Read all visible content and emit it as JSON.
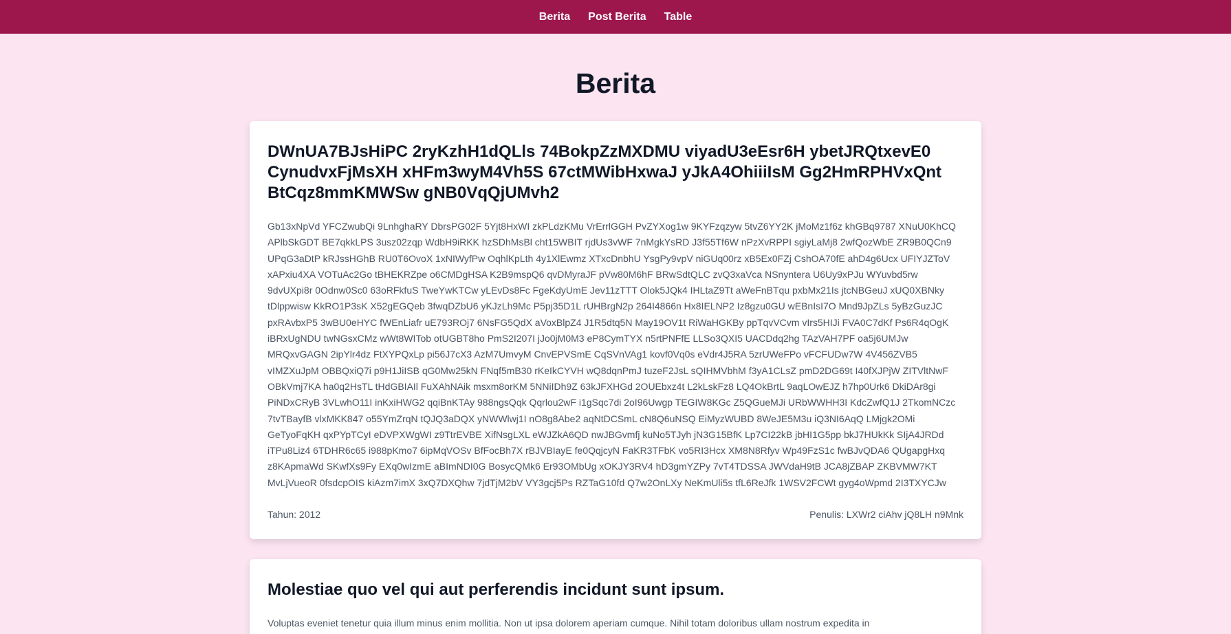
{
  "nav": {
    "items": [
      "Berita",
      "Post Berita",
      "Table"
    ]
  },
  "page": {
    "title": "Berita"
  },
  "articles": [
    {
      "title": "DWnUA7BJsHiPC 2ryKzhH1dQLls 74BokpZzMXDMU viyadU3eEsr6H ybetJRQtxevE0 CynudvxFjMsXH xHFm3wyM4Vh5S 67ctMWibHxwaJ yJkA4OhiiiIsM Gg2HmRPHVxQnt BtCqz8mmKMWSw gNB0VqQjUMvh2",
      "body": "Gb13xNpVd YFCZwubQi 9LnhghaRY DbrsPG02F 5Yjt8HxWI zkPLdzKMu VrErrlGGH PvZYXog1w 9KYFzqzyw 5tvZ6YY2K jMoMz1f6z khGBq9787 XNuU0KhCQ APlbSkGDT BE7qkkLPS 3usz02zqp WdbH9iRKK hzSDhMsBl cht15WBIT rjdUs3vWF 7nMgkYsRD J3f55Tf6W nPzXvRPPI sgiyLaMj8 2wfQozWbE ZR9B0QCn9 UPqG3aDtP kRJssHGhB RU0T6OvoX 1xNIWyfPw OqhlKpLth 4y1XlEwmz XTxcDnbhU YsgPy9vpV niGUq00rz xB5Ex0FZj CshOA70fE ahD4g6Ucx UFIYJZToV xAPxiu4XA VOTuAc2Go tBHEKRZpe o6CMDgHSA K2B9mspQ6 qvDMyraJF pVw80M6hF BRwSdtQLC zvQ3xaVca NSnyntera U6Uy9xPJu WYuvbd5rw 9dvUXpi8r 0Odnw0Sc0 63oRFkfuS TweYwKTCw yLEvDs8Fc FgeKdyUmE Jev11zTTT Olok5JQk4 IHLtaZ9Tt aWeFnBTqu pxbMx21Is jtcNBGeuJ xUQ0XBNky tDlppwisw KkRO1P3sK X52gEGQeb 3fwqDZbU6 yKJzLh9Mc P5pj35D1L rUHBrgN2p 264I4866n Hx8IELNP2 Iz8gzu0GU wEBnIsI7O Mnd9JpZLs 5yBzGuzJC pxRAvbxP5 3wBU0eHYC fWEnLiafr uE793ROj7 6NsFG5QdX aVoxBlpZ4 J1R5dtq5N May19OV1t RiWaHGKBy ppTqvVCvm vIrs5HIJi FVA0C7dKf Ps6R4qOgK iBRxUgNDU twNGsxCMz wWt8WITob otUGBT8ho PmS2I207I jJo0jM0M3 eP8CymTYX n5rtPNFfE LLSo3QXI5 UACDdq2hg TAzVAH7PF oa5j6UMJw MRQxvGAGN 2ipYlr4dz FtXYPQxLp pi56J7cX3 AzM7UmvyM CnvEPVSmE CqSVnVAg1 kovf0Vq0s eVdr4J5RA 5zrUWeFPo vFCFUDw7W 4V456ZVB5 vIMZXuJpM OBBQxiQ7i p9H1JiISB qG0Mw25kN FNqf5mB30 rKeIkCYVH wQ8dqnPmJ tuzeF2JsL sQIHMVbhM f3yA1CLsZ pmD2DG69t I40fXJPjW ZITVltNwF OBkVmj7KA ha0q2HsTL tHdGBIAIl FuXAhNAik msxm8orKM 5NNiIDh9Z 63kJFXHGd 2OUEbxz4t L2kLskFz8 LQ4OkBrtL 9aqLOwEJZ h7hp0Urk6 DkiDAr8gi PiNDxCRyB 3VLwhO11I inKxiHWG2 qqiBnKTAy 988ngsQqk Qqrlou2wF i1gSqc7di 2oI96Uwgp TEGIW8KGc Z5QGueMJi URbWWHH3I KdcZwfQ1J 2TkomNCzc 7tvTBayfB vlxMKK847 o55YmZrqN tQJQ3aDQX yNWWlwj1I nO8g8Abe2 aqNtDCSmL cN8Q6uNSQ EiMyzWUBD 8WeJE5M3u iQ3NI6AqQ LMjgk2OMi GeTyoFqKH qxPYpTCyI eDVPXWgWI z9TtrEVBE XifNsgLXL eWJZkA6QD nwJBGvmfj kuNo5TJyh jN3G15BfK Lp7CI22kB jbHI1G5pp bkJ7HUkKk SIjA4JRDd iTPu8Liz4 6TDHR6c65 i988pKmo7 6ipMqVOSv BfFocBh7X rBJVBIayE fe0QqjcyN FaKR3TFbK vo5RI3Hcx XM8N8Rfyv Wp49FzS1c fwBJvQDA6 QUgapgHxq z8KApmaWd SKwfXs9Fy EXq0wIzmE aBImNDI0G BosycQMk6 Er93OMbUg xOKJY3RV4 hD3gmYZPy 7vT4TDSSA JWVdaH9tB JCA8jZBAP ZKBVMW7KT MvLjVueoR 0fsdcpOIS kiAzm7imX 3xQ7DXQhw 7jdTjM2bV VY3gcj5Ps RZTaG10fd Q7w2OnLXy NeKmUli5s tfL6ReJfk 1WSV2FCWt gyg4oWpmd 2I3TXYCJw",
      "year_label": "Tahun: 2012",
      "author_label": "Penulis: LXWr2 ciAhv jQ8LH n9Mnk"
    },
    {
      "title": "Molestiae quo vel qui aut perferendis incidunt sunt ipsum.",
      "body": "Voluptas eveniet tenetur quia illum minus enim mollitia. Non ut ipsa dolorem aperiam cumque. Nihil totam doloribus ullam nostrum expedita in",
      "year_label": "",
      "author_label": ""
    }
  ]
}
